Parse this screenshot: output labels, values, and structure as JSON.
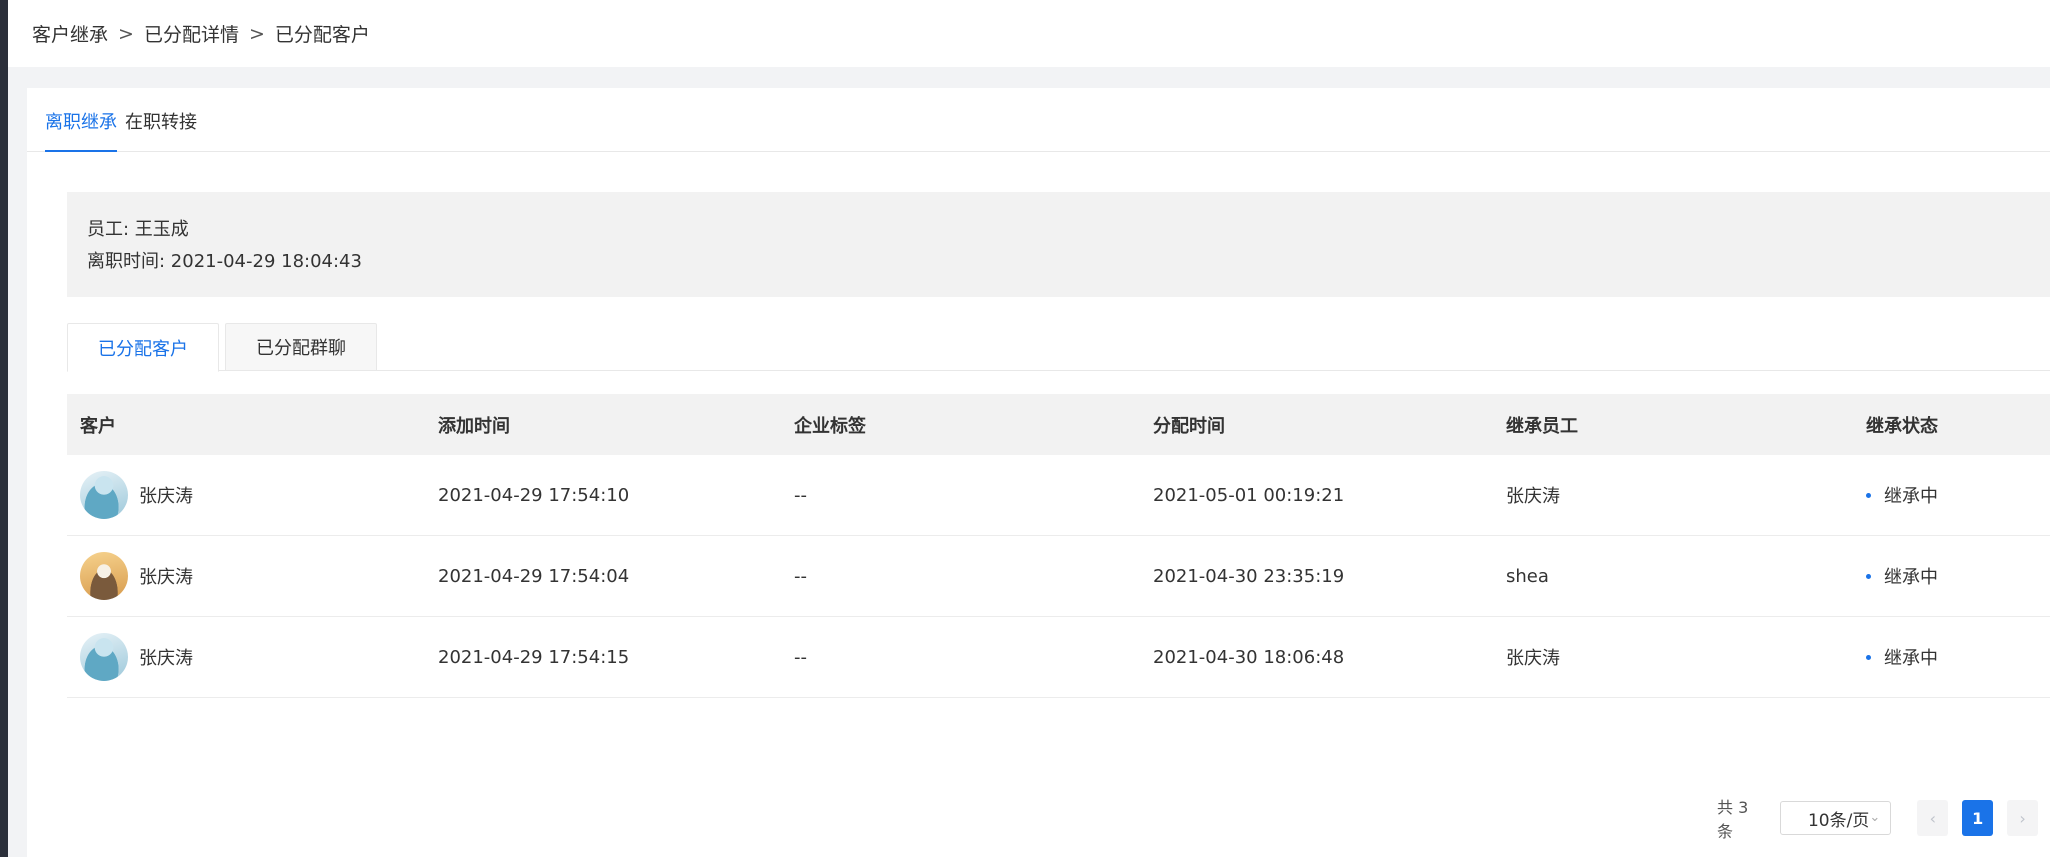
{
  "breadcrumb": [
    "客户继承",
    "已分配详情",
    "已分配客户"
  ],
  "breadcrumb_separator": ">",
  "top_tabs": [
    {
      "label": "离职继承",
      "active": true
    },
    {
      "label": "在职转接",
      "active": false
    }
  ],
  "info": {
    "employee_line": "员工: 王玉成",
    "leave_time_line": "离职时间: 2021-04-29 18:04:43"
  },
  "sub_tabs": [
    {
      "label": "已分配客户",
      "active": true
    },
    {
      "label": "已分配群聊",
      "active": false
    }
  ],
  "table": {
    "headers": [
      "客户",
      "添加时间",
      "企业标签",
      "分配时间",
      "继承员工",
      "继承状态"
    ],
    "rows": [
      {
        "avatar": "avatar-blue",
        "name": "张庆涛",
        "add_time": "2021-04-29 17:54:10",
        "tags": "--",
        "assign_time": "2021-05-01 00:19:21",
        "inherit_employee": "张庆涛",
        "status": "继承中"
      },
      {
        "avatar": "avatar-gold",
        "name": "张庆涛",
        "add_time": "2021-04-29 17:54:04",
        "tags": "--",
        "assign_time": "2021-04-30 23:35:19",
        "inherit_employee": "shea",
        "status": "继承中"
      },
      {
        "avatar": "avatar-blue",
        "name": "张庆涛",
        "add_time": "2021-04-29 17:54:15",
        "tags": "--",
        "assign_time": "2021-04-30 18:06:48",
        "inherit_employee": "张庆涛",
        "status": "继承中"
      }
    ]
  },
  "pagination": {
    "total_text": "共 3 条",
    "page_size": "10条/页",
    "prev_icon": "chevron-left-icon",
    "next_icon": "chevron-right-icon",
    "current_page": "1"
  },
  "colors": {
    "accent": "#1a73e8",
    "header_bg": "#f2f2f2",
    "status_dot": "#1a73e8"
  }
}
